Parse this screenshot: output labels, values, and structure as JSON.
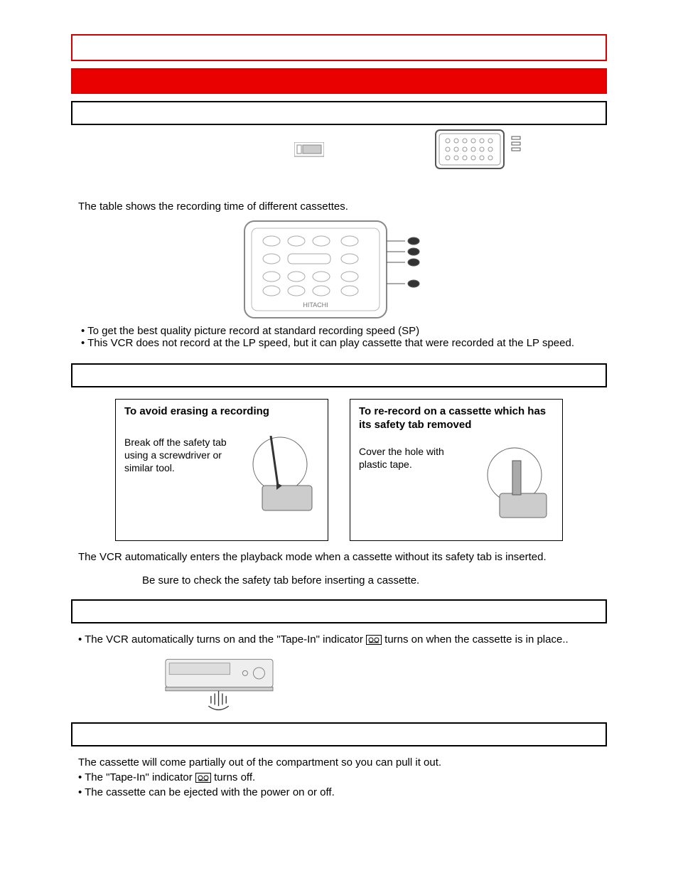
{
  "section": {
    "intro_table_note": "The table shows the recording time of different cassettes.",
    "sp_bullet1": "• To get the best quality picture record at standard recording speed (SP)",
    "sp_bullet2": "• This VCR does not record at the LP speed, but it can play cassette that were recorded at the LP speed."
  },
  "panels": {
    "left": {
      "title": "To avoid erasing a recording",
      "text": "Break off the safety tab using a screwdriver or similar tool."
    },
    "right": {
      "title": "To re-record on a cassette which has its safety tab removed",
      "text": "Cover the hole with plastic tape."
    }
  },
  "safety": {
    "auto_play": "The VCR automatically enters the playback mode when a cassette without its safety tab is inserted.",
    "check_tab": "Be sure to check the safety tab before inserting a cassette."
  },
  "tape_in": {
    "line_pre": "• The VCR automatically turns on and the \"Tape-In\" indicator ",
    "line_post": " turns on when the cassette is in place.."
  },
  "eject": {
    "partial": "The cassette will come partially out of the compartment so you can pull it out.",
    "off_pre": "• The \"Tape-In\" indicator ",
    "off_post": " turns off.",
    "power": "• The cassette can be ejected with the power on or off."
  }
}
